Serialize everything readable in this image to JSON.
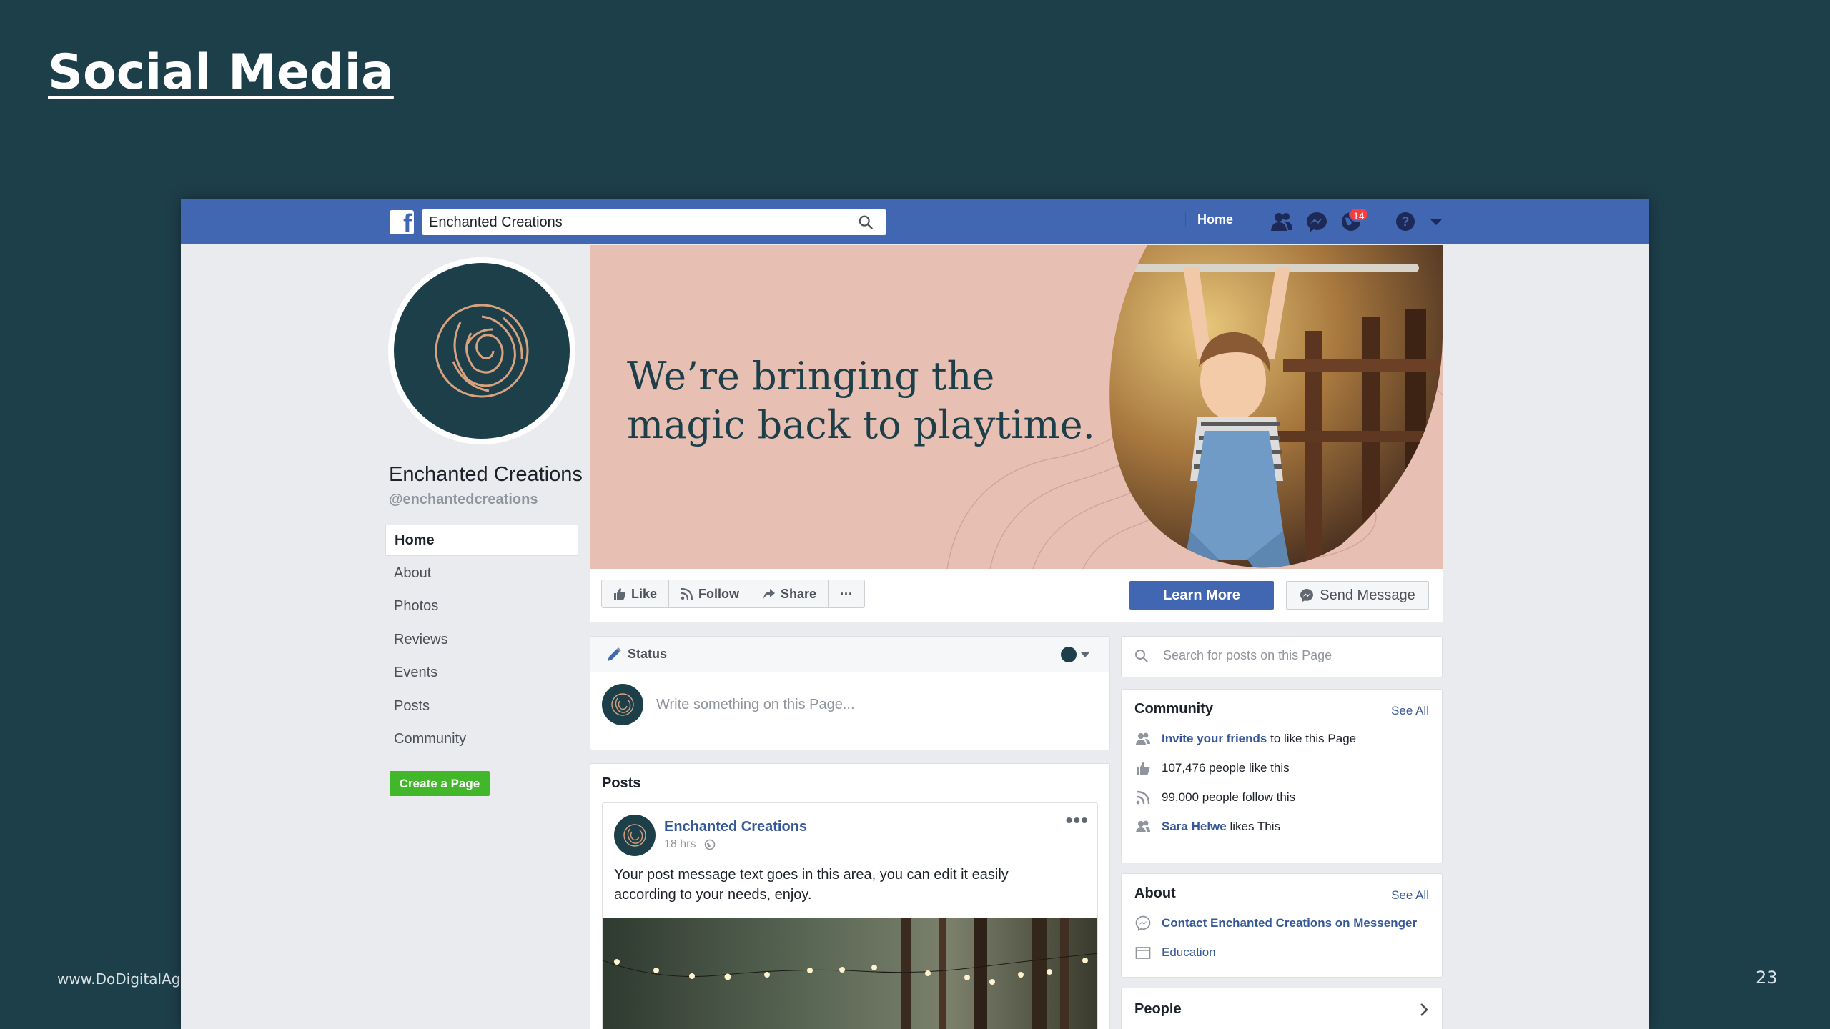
{
  "slide": {
    "title": "Social Media",
    "footer_url": "www.DoDigitalAgency.com",
    "page_number": "23"
  },
  "colors": {
    "background": "#1d3f4a",
    "facebook_blue": "#4267b2",
    "cover_pink": "#e8bfb3",
    "create_page_green": "#42b72a",
    "badge_red": "#fa3e3e"
  },
  "topbar": {
    "logo_icon": "facebook-logo-icon",
    "search_value": "Enchanted Creations",
    "home_label": "Home",
    "notification_count": "14",
    "icons": [
      "friends-icon",
      "messenger-icon",
      "notifications-globe-icon",
      "help-icon",
      "dropdown-arrow-icon"
    ]
  },
  "page": {
    "name": "Enchanted Creations",
    "handle": "@enchantedcreations",
    "nav": [
      "Home",
      "About",
      "Photos",
      "Reviews",
      "Events",
      "Posts",
      "Community"
    ],
    "active_nav": "Home",
    "create_page_label": "Create a Page"
  },
  "cover": {
    "tagline_line1": "We’re bringing the",
    "tagline_line2": "magic back to playtime."
  },
  "actions": {
    "like": "Like",
    "follow": "Follow",
    "share": "Share",
    "more": "···",
    "learn_more": "Learn More",
    "send_message": "Send Message"
  },
  "composer": {
    "status_label": "Status",
    "placeholder": "Write something on this Page..."
  },
  "posts": {
    "title": "Posts",
    "author": "Enchanted Creations",
    "time": "18 hrs",
    "more": "•••",
    "text": "Your post message text goes in this area, you can edit it easily according to your needs, enjoy."
  },
  "sidebar": {
    "search_placeholder": "Search for posts on this Page",
    "community": {
      "title": "Community",
      "see_all": "See All",
      "invite_link": "Invite your friends",
      "invite_rest": " to like this Page",
      "likes": "107,476 people like this",
      "follows": "99,000 people follow this",
      "friend_name": "Sara Helwe",
      "friend_rest": " likes This"
    },
    "about": {
      "title": "About",
      "see_all": "See All",
      "messenger": "Contact Enchanted Creations on Messenger",
      "category": "Education"
    },
    "people": {
      "title": "People"
    }
  }
}
